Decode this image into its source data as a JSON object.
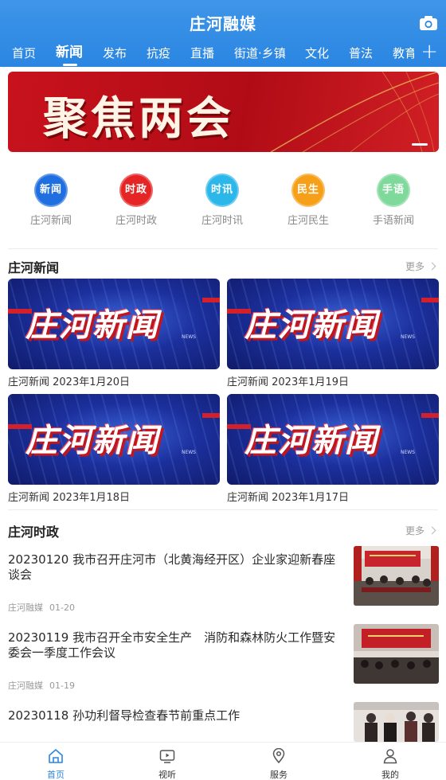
{
  "header": {
    "title": "庄河融媒",
    "tabs": [
      "首页",
      "新闻",
      "发布",
      "抗疫",
      "直播",
      "街道·乡镇",
      "文化",
      "普法",
      "教育"
    ],
    "active_tab_index": 1,
    "camera_icon": "camera-icon",
    "add_icon": "plus-icon"
  },
  "banner": {
    "text": "聚焦两会"
  },
  "shortcuts": [
    {
      "icon_text": "新闻",
      "label": "庄河新闻",
      "color": "#1f6fe0"
    },
    {
      "icon_text": "时政",
      "label": "庄河时政",
      "color": "#e52525"
    },
    {
      "icon_text": "时讯",
      "label": "庄河时讯",
      "color": "#2bb7ea"
    },
    {
      "icon_text": "民生",
      "label": "庄河民生",
      "color": "#f6a019"
    },
    {
      "icon_text": "手语",
      "label": "手语新闻",
      "color": "#7fd99a"
    }
  ],
  "news_section": {
    "title": "庄河新闻",
    "more": "更多",
    "thumb_logo": "庄河新闻",
    "thumb_tag": "NEWS",
    "cards": [
      {
        "caption": "庄河新闻 2023年1月20日"
      },
      {
        "caption": "庄河新闻 2023年1月19日"
      },
      {
        "caption": "庄河新闻 2023年1月18日"
      },
      {
        "caption": "庄河新闻 2023年1月17日"
      }
    ]
  },
  "politics_section": {
    "title": "庄河时政",
    "more": "更多",
    "articles": [
      {
        "title": "20230120 我市召开庄河市（北黄海经开区）企业家迎新春座谈会",
        "source": "庄河融媒",
        "date": "01-20"
      },
      {
        "title": "20230119 我市召开全市安全生产　消防和森林防火工作暨安委会一季度工作会议",
        "source": "庄河融媒",
        "date": "01-19"
      },
      {
        "title": "20230118 孙功利督导检查春节前重点工作",
        "source": "",
        "date": ""
      }
    ]
  },
  "bottom_nav": [
    {
      "label": "首页",
      "icon": "home-icon",
      "active": true
    },
    {
      "label": "视听",
      "icon": "tv-icon",
      "active": false
    },
    {
      "label": "服务",
      "icon": "location-icon",
      "active": false
    },
    {
      "label": "我的",
      "icon": "user-icon",
      "active": false
    }
  ],
  "colors": {
    "accent": "#2a86e2",
    "banner_red": "#c8121d"
  }
}
